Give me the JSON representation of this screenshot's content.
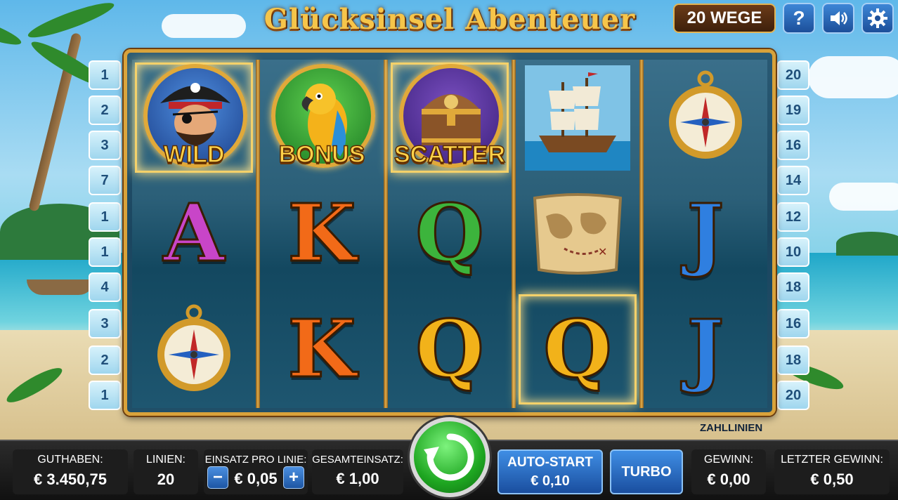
{
  "title": "Glücksinsel Abenteuer",
  "ways_badge": "20 WEGE",
  "top_buttons": {
    "help": "?",
    "sound_icon": "speaker-icon",
    "settings_icon": "gear-icon"
  },
  "reels": [
    [
      {
        "symbol": "pirate",
        "label": "WILD"
      },
      {
        "symbol": "letter",
        "label": "A",
        "color": "#c845c8"
      },
      {
        "symbol": "compass",
        "label": ""
      }
    ],
    [
      {
        "symbol": "parrot",
        "label": "BONUS"
      },
      {
        "symbol": "letter",
        "label": "K",
        "color": "#f26a18"
      },
      {
        "symbol": "letter",
        "label": "K",
        "color": "#f26a18"
      }
    ],
    [
      {
        "symbol": "treasure-chest",
        "label": "SCATTER"
      },
      {
        "symbol": "letter",
        "label": "Q",
        "color": "#3cb43c"
      },
      {
        "symbol": "letter",
        "label": "Q",
        "color": "#f2b21a"
      }
    ],
    [
      {
        "symbol": "ship",
        "label": ""
      },
      {
        "symbol": "map",
        "label": ""
      },
      {
        "symbol": "letter",
        "label": "Q",
        "color": "#f2b21a"
      }
    ],
    [
      {
        "symbol": "compass",
        "label": ""
      },
      {
        "symbol": "letter",
        "label": "J",
        "color": "#2f7fe0"
      },
      {
        "symbol": "letter",
        "label": "J",
        "color": "#2f7fe0"
      }
    ]
  ],
  "paylines_left": [
    "1",
    "2",
    "3",
    "7",
    "1",
    "1",
    "4",
    "3",
    "2",
    "1"
  ],
  "paylines_right": [
    "20",
    "19",
    "16",
    "14",
    "12",
    "10",
    "18",
    "16",
    "18",
    "20"
  ],
  "paylines_caption": "ZAHLLINIEN",
  "footer": {
    "balance_label": "GUTHABEN:",
    "balance_value": "€ 3.450,75",
    "lines_label": "LINIEN:",
    "lines_value": "20",
    "bet_per_line_label": "EINSATZ PRO LINIE:",
    "bet_per_line_value": "€ 0,05",
    "minus": "−",
    "plus": "+",
    "total_bet_label": "GESAMTEINSATZ:",
    "total_bet_value": "€ 1,00",
    "autostart_label": "AUTO-START",
    "autostart_value": "€ 0,10",
    "turbo_label": "TURBO",
    "win_label": "GEWINN:",
    "win_value": "€ 0,00",
    "last_win_label": "LETZTER GEWINN:",
    "last_win_value": "€ 0,50"
  }
}
